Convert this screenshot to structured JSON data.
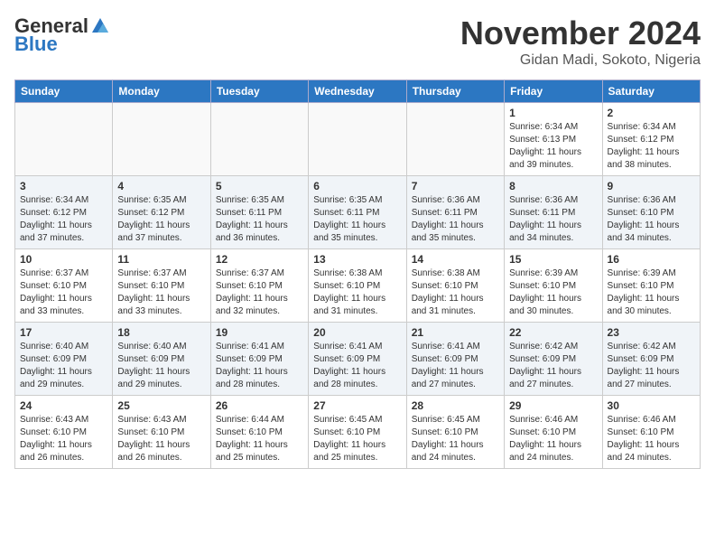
{
  "header": {
    "logo_line1": "General",
    "logo_line2": "Blue",
    "month_title": "November 2024",
    "subtitle": "Gidan Madi, Sokoto, Nigeria"
  },
  "days_of_week": [
    "Sunday",
    "Monday",
    "Tuesday",
    "Wednesday",
    "Thursday",
    "Friday",
    "Saturday"
  ],
  "weeks": [
    [
      {
        "day": "",
        "info": ""
      },
      {
        "day": "",
        "info": ""
      },
      {
        "day": "",
        "info": ""
      },
      {
        "day": "",
        "info": ""
      },
      {
        "day": "",
        "info": ""
      },
      {
        "day": "1",
        "info": "Sunrise: 6:34 AM\nSunset: 6:13 PM\nDaylight: 11 hours and 39 minutes."
      },
      {
        "day": "2",
        "info": "Sunrise: 6:34 AM\nSunset: 6:12 PM\nDaylight: 11 hours and 38 minutes."
      }
    ],
    [
      {
        "day": "3",
        "info": "Sunrise: 6:34 AM\nSunset: 6:12 PM\nDaylight: 11 hours and 37 minutes."
      },
      {
        "day": "4",
        "info": "Sunrise: 6:35 AM\nSunset: 6:12 PM\nDaylight: 11 hours and 37 minutes."
      },
      {
        "day": "5",
        "info": "Sunrise: 6:35 AM\nSunset: 6:11 PM\nDaylight: 11 hours and 36 minutes."
      },
      {
        "day": "6",
        "info": "Sunrise: 6:35 AM\nSunset: 6:11 PM\nDaylight: 11 hours and 35 minutes."
      },
      {
        "day": "7",
        "info": "Sunrise: 6:36 AM\nSunset: 6:11 PM\nDaylight: 11 hours and 35 minutes."
      },
      {
        "day": "8",
        "info": "Sunrise: 6:36 AM\nSunset: 6:11 PM\nDaylight: 11 hours and 34 minutes."
      },
      {
        "day": "9",
        "info": "Sunrise: 6:36 AM\nSunset: 6:10 PM\nDaylight: 11 hours and 34 minutes."
      }
    ],
    [
      {
        "day": "10",
        "info": "Sunrise: 6:37 AM\nSunset: 6:10 PM\nDaylight: 11 hours and 33 minutes."
      },
      {
        "day": "11",
        "info": "Sunrise: 6:37 AM\nSunset: 6:10 PM\nDaylight: 11 hours and 33 minutes."
      },
      {
        "day": "12",
        "info": "Sunrise: 6:37 AM\nSunset: 6:10 PM\nDaylight: 11 hours and 32 minutes."
      },
      {
        "day": "13",
        "info": "Sunrise: 6:38 AM\nSunset: 6:10 PM\nDaylight: 11 hours and 31 minutes."
      },
      {
        "day": "14",
        "info": "Sunrise: 6:38 AM\nSunset: 6:10 PM\nDaylight: 11 hours and 31 minutes."
      },
      {
        "day": "15",
        "info": "Sunrise: 6:39 AM\nSunset: 6:10 PM\nDaylight: 11 hours and 30 minutes."
      },
      {
        "day": "16",
        "info": "Sunrise: 6:39 AM\nSunset: 6:10 PM\nDaylight: 11 hours and 30 minutes."
      }
    ],
    [
      {
        "day": "17",
        "info": "Sunrise: 6:40 AM\nSunset: 6:09 PM\nDaylight: 11 hours and 29 minutes."
      },
      {
        "day": "18",
        "info": "Sunrise: 6:40 AM\nSunset: 6:09 PM\nDaylight: 11 hours and 29 minutes."
      },
      {
        "day": "19",
        "info": "Sunrise: 6:41 AM\nSunset: 6:09 PM\nDaylight: 11 hours and 28 minutes."
      },
      {
        "day": "20",
        "info": "Sunrise: 6:41 AM\nSunset: 6:09 PM\nDaylight: 11 hours and 28 minutes."
      },
      {
        "day": "21",
        "info": "Sunrise: 6:41 AM\nSunset: 6:09 PM\nDaylight: 11 hours and 27 minutes."
      },
      {
        "day": "22",
        "info": "Sunrise: 6:42 AM\nSunset: 6:09 PM\nDaylight: 11 hours and 27 minutes."
      },
      {
        "day": "23",
        "info": "Sunrise: 6:42 AM\nSunset: 6:09 PM\nDaylight: 11 hours and 27 minutes."
      }
    ],
    [
      {
        "day": "24",
        "info": "Sunrise: 6:43 AM\nSunset: 6:10 PM\nDaylight: 11 hours and 26 minutes."
      },
      {
        "day": "25",
        "info": "Sunrise: 6:43 AM\nSunset: 6:10 PM\nDaylight: 11 hours and 26 minutes."
      },
      {
        "day": "26",
        "info": "Sunrise: 6:44 AM\nSunset: 6:10 PM\nDaylight: 11 hours and 25 minutes."
      },
      {
        "day": "27",
        "info": "Sunrise: 6:45 AM\nSunset: 6:10 PM\nDaylight: 11 hours and 25 minutes."
      },
      {
        "day": "28",
        "info": "Sunrise: 6:45 AM\nSunset: 6:10 PM\nDaylight: 11 hours and 24 minutes."
      },
      {
        "day": "29",
        "info": "Sunrise: 6:46 AM\nSunset: 6:10 PM\nDaylight: 11 hours and 24 minutes."
      },
      {
        "day": "30",
        "info": "Sunrise: 6:46 AM\nSunset: 6:10 PM\nDaylight: 11 hours and 24 minutes."
      }
    ]
  ]
}
